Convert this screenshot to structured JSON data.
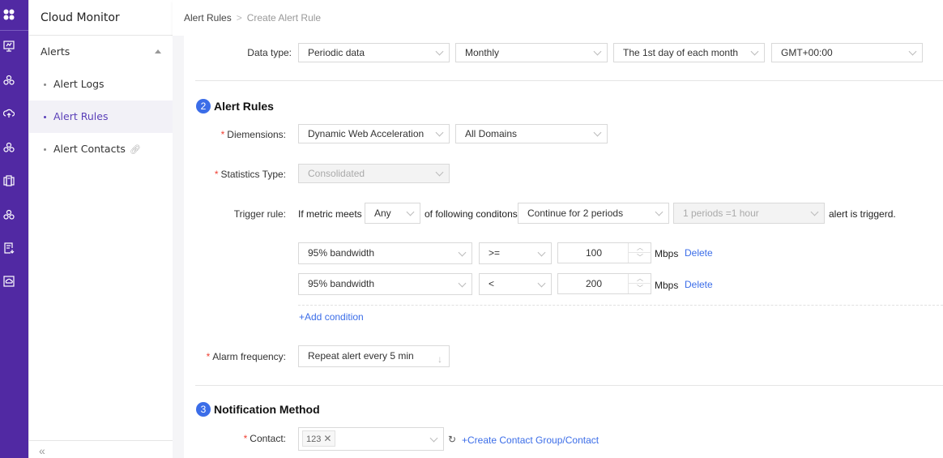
{
  "rail": {
    "icons": [
      "apps-grid-icon",
      "monitor-dashboard-icon",
      "cluster-icon",
      "cloud-upload-icon",
      "cluster-icon-2",
      "server-icon",
      "cluster-icon-3",
      "report-download-icon",
      "cloud-screen-icon"
    ]
  },
  "nav": {
    "title": "Cloud Monitor",
    "group": "Alerts",
    "items": [
      {
        "label": "Alert Logs",
        "active": false
      },
      {
        "label": "Alert Rules",
        "active": true
      },
      {
        "label": "Alert Contacts",
        "active": false
      }
    ],
    "collapse": "«"
  },
  "breadcrumb": {
    "parent": "Alert Rules",
    "separator": ">",
    "current": "Create Alert Rule"
  },
  "datatype": {
    "label": "Data type:",
    "type": "Periodic data",
    "period": "Monthly",
    "day": "The 1st day of each month",
    "timezone": "GMT+00:00"
  },
  "section2": {
    "number": "2",
    "title": "Alert Rules",
    "dimensions_label": "Diemensions:",
    "dimension1": "Dynamic Web Acceleration (",
    "dimension2": "All Domains",
    "stats_label": "Statistics Type:",
    "stats_value": "Consolidated",
    "trigger_label": "Trigger rule:",
    "trigger_prefix": "If metric meets",
    "trigger_match": "Any",
    "trigger_middle": "of following conditons,",
    "trigger_continue": "Continue for 2 periods",
    "trigger_period": "1 periods =1 hour",
    "trigger_suffix": "alert is triggerd.",
    "conditions": [
      {
        "metric": "95% bandwidth",
        "op": ">=",
        "value": "100",
        "unit": "Mbps",
        "delete": "Delete"
      },
      {
        "metric": "95% bandwidth",
        "op": "<",
        "value": "200",
        "unit": "Mbps",
        "delete": "Delete"
      }
    ],
    "add_condition": "+Add condition",
    "freq_label": "Alarm frequency:",
    "freq_value": "Repeat alert every 5 min"
  },
  "section3": {
    "number": "3",
    "title": "Notification Method",
    "contact_label": "Contact:",
    "contact_tag": "123",
    "create_link": "+Create Contact Group/Contact"
  },
  "colors": {
    "rail": "#5129a3",
    "accent": "#3b6de8",
    "active_nav": "#5a3fb8",
    "required": "#f04134"
  }
}
